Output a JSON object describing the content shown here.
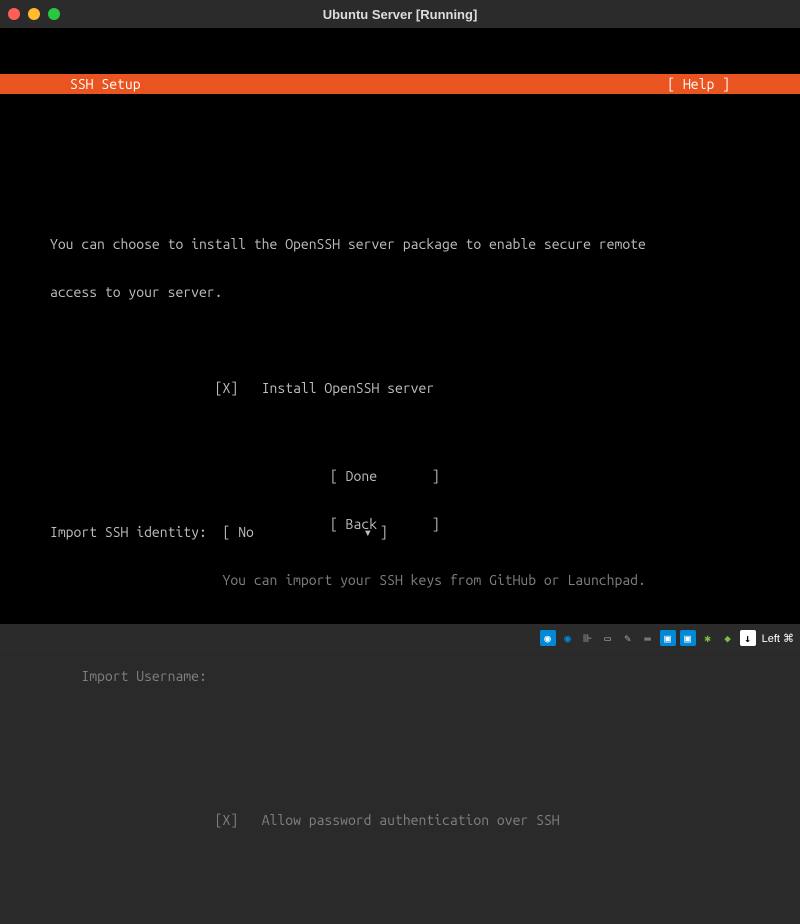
{
  "window": {
    "title": "Ubuntu Server [Running]"
  },
  "header": {
    "title": "SSH Setup",
    "help": "[ Help ]"
  },
  "intro": {
    "line1": "You can choose to install the OpenSSH server package to enable secure remote",
    "line2": "access to your server."
  },
  "install_openssh": {
    "checkbox": "[X]",
    "label": "Install OpenSSH server"
  },
  "import_identity": {
    "label": "Import SSH identity:",
    "bracket_open": "[ ",
    "value": "No",
    "arrow": "▾",
    "bracket_close": " ]",
    "hint": "You can import your SSH keys from GitHub or Launchpad."
  },
  "import_username": {
    "label": "Import Username:"
  },
  "allow_password": {
    "checkbox": "[X]",
    "label": "Allow password authentication over SSH"
  },
  "actions": {
    "done": "[ Done       ]",
    "back": "[ Back       ]"
  },
  "statusbar": {
    "left_text": "Left ⌘"
  }
}
